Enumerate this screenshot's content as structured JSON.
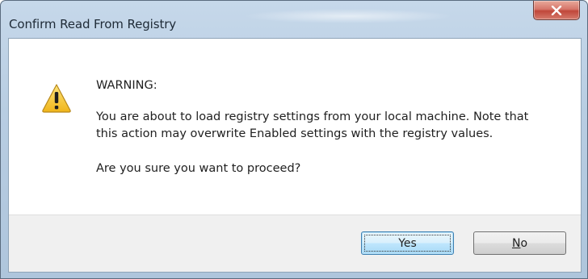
{
  "window": {
    "title": "Confirm Read From Registry",
    "close_icon": "close-icon"
  },
  "dialog": {
    "icon": "warning-icon",
    "heading": "WARNING:",
    "message": "You are about to load registry settings from your local machine. Note that this action may overwrite Enabled settings with the registry values.",
    "question": "Are you sure you want to proceed?"
  },
  "buttons": {
    "yes_label": "Yes",
    "no_mnemonic": "N",
    "no_rest": "o"
  },
  "colors": {
    "warning_yellow": "#f4c521",
    "close_red": "#c0473a",
    "default_button_border": "#3c7fb1"
  }
}
